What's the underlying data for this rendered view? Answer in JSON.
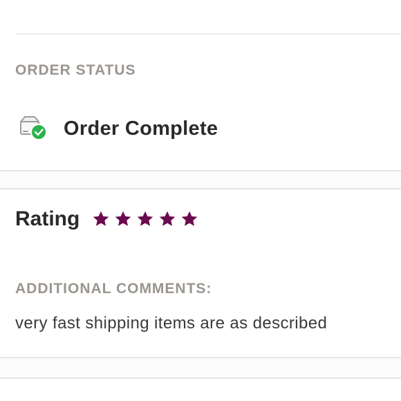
{
  "order_status": {
    "heading": "ORDER STATUS",
    "icon": "package-check-icon",
    "text": "Order Complete"
  },
  "rating": {
    "label": "Rating",
    "stars": 5,
    "max_stars": 5,
    "star_color": "#6b0b4f"
  },
  "comments": {
    "heading": "ADDITIONAL COMMENTS:",
    "text": "very fast shipping items are as described"
  },
  "colors": {
    "heading_gray": "#9a958f",
    "text_dark": "#2a2a2a",
    "check_green": "#2bb24c"
  }
}
